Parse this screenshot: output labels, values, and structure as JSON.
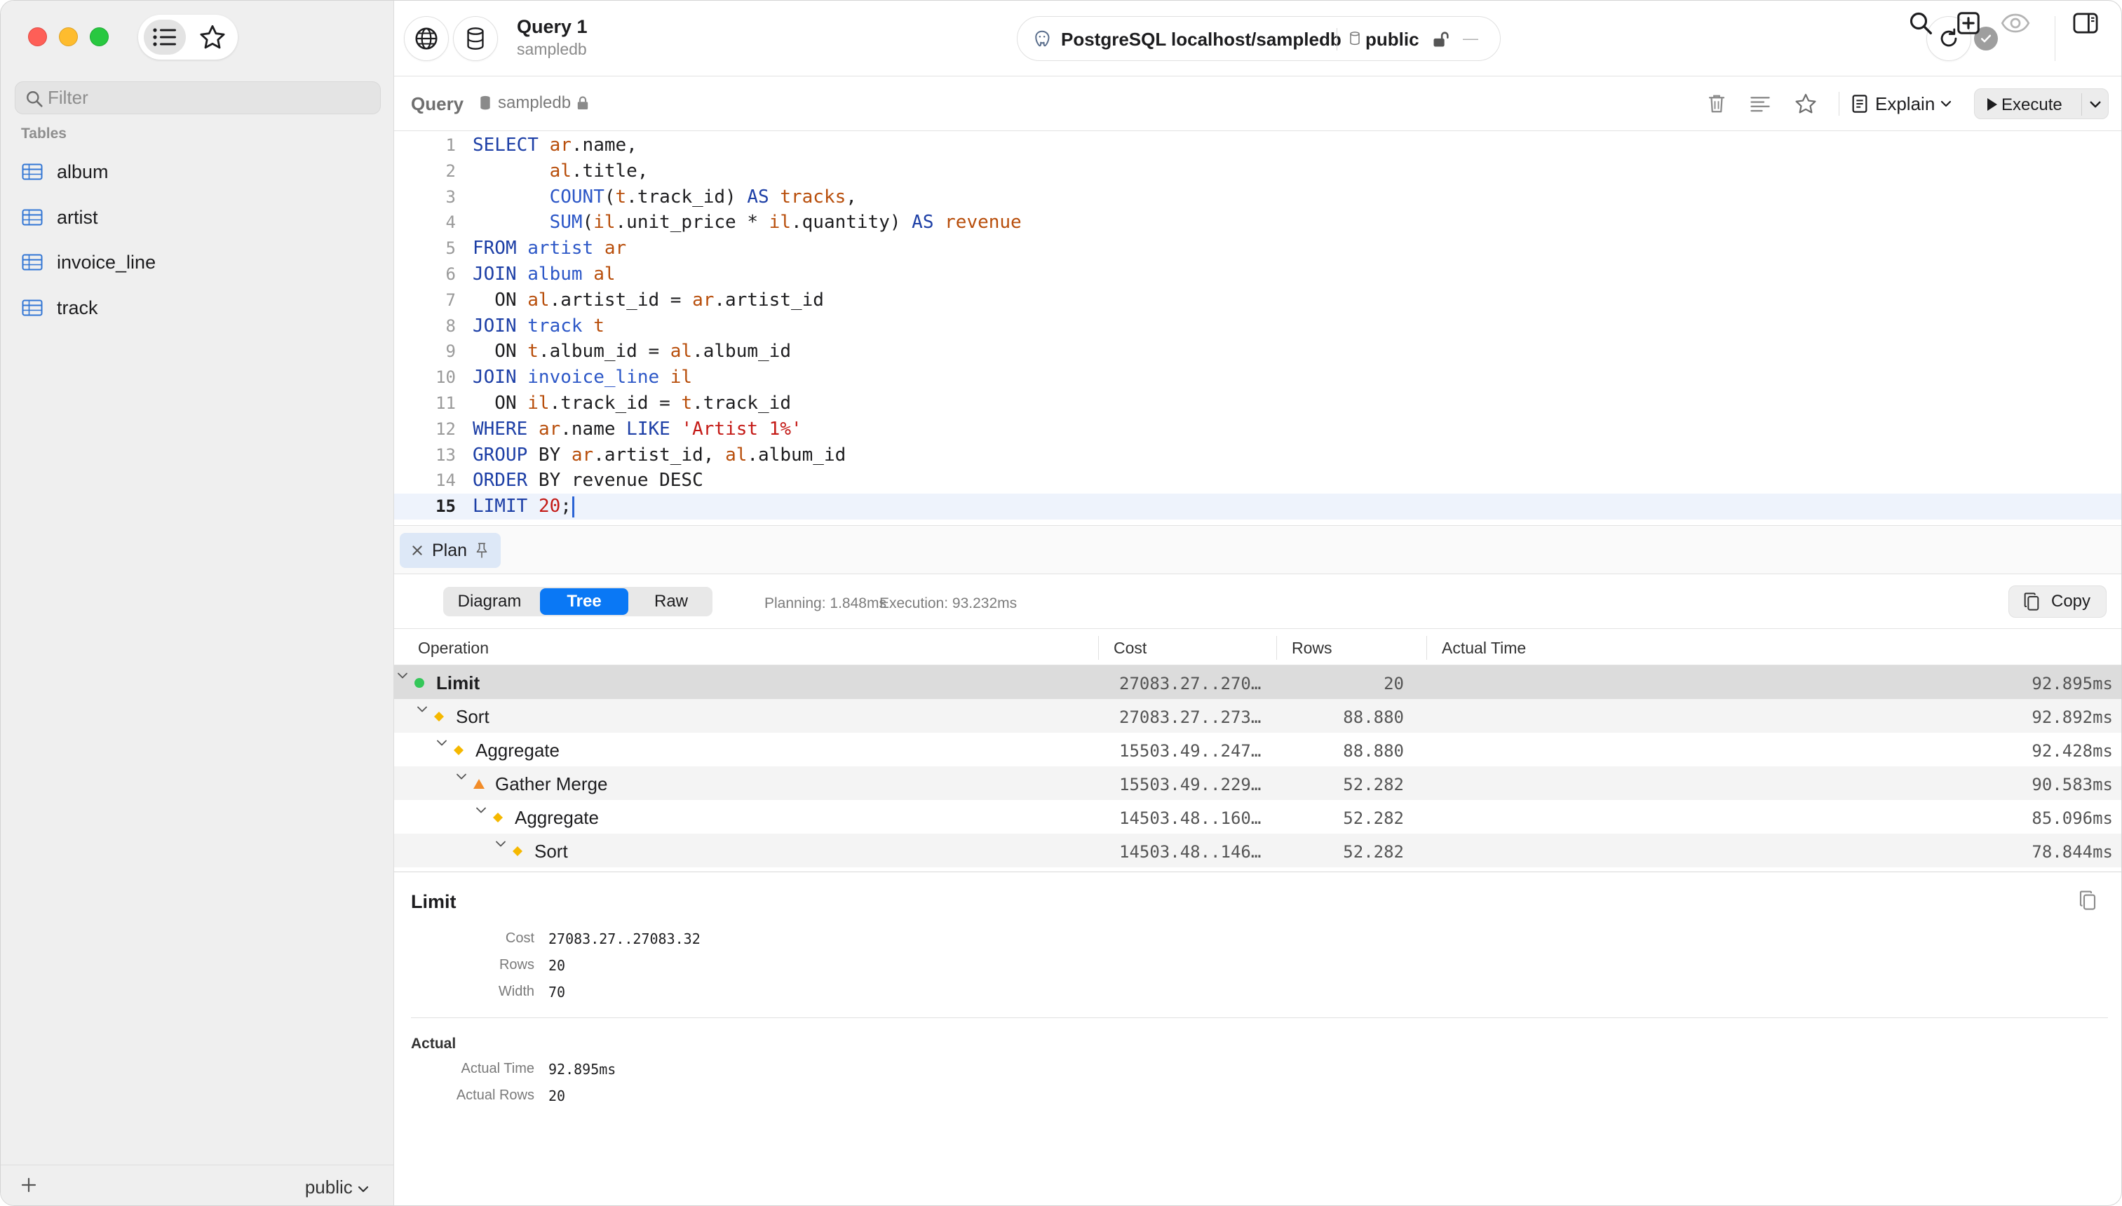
{
  "sidebar": {
    "filter_placeholder": "Filter",
    "tables_heading": "Tables",
    "tables": [
      {
        "label": "album"
      },
      {
        "label": "artist"
      },
      {
        "label": "invoice_line"
      },
      {
        "label": "track"
      }
    ],
    "schema_selector": "public"
  },
  "toolbar": {
    "query_title": "Query 1",
    "query_subtitle": "sampledb",
    "connection_label": "PostgreSQL localhost/sampledb",
    "schema_label": "public",
    "dash": "—"
  },
  "query_header": {
    "label": "Query",
    "database": "sampledb",
    "explain_label": "Explain",
    "execute_label": "Execute"
  },
  "editor": {
    "active_line": 15,
    "lines": [
      {
        "n": "1",
        "tokens": [
          [
            "kw",
            "SELECT"
          ],
          [
            "",
            "&nbsp;"
          ],
          [
            "al",
            "ar"
          ],
          [
            "",
            ".name,"
          ]
        ]
      },
      {
        "n": "2",
        "tokens": [
          [
            "",
            "       "
          ],
          [
            "al",
            "al"
          ],
          [
            "",
            ".title,"
          ]
        ]
      },
      {
        "n": "3",
        "tokens": [
          [
            "",
            "       "
          ],
          [
            "fn",
            "COUNT"
          ],
          [
            "",
            "("
          ],
          [
            "al",
            "t"
          ],
          [
            "",
            ".track_id) "
          ],
          [
            "kw",
            "AS"
          ],
          [
            "",
            " "
          ],
          [
            "al",
            "tracks"
          ],
          [
            "",
            ","
          ]
        ]
      },
      {
        "n": "4",
        "tokens": [
          [
            "",
            "       "
          ],
          [
            "fn",
            "SUM"
          ],
          [
            "",
            "("
          ],
          [
            "al",
            "il"
          ],
          [
            "",
            ".unit_price * "
          ],
          [
            "al",
            "il"
          ],
          [
            "",
            ".quantity) "
          ],
          [
            "kw",
            "AS"
          ],
          [
            "",
            " "
          ],
          [
            "al",
            "revenue"
          ]
        ]
      },
      {
        "n": "5",
        "tokens": [
          [
            "kw",
            "FROM"
          ],
          [
            "",
            " "
          ],
          [
            "tb",
            "artist"
          ],
          [
            "",
            " "
          ],
          [
            "al",
            "ar"
          ]
        ]
      },
      {
        "n": "6",
        "tokens": [
          [
            "kw",
            "JOIN"
          ],
          [
            "",
            " "
          ],
          [
            "tb",
            "album"
          ],
          [
            "",
            " "
          ],
          [
            "al",
            "al"
          ]
        ]
      },
      {
        "n": "7",
        "tokens": [
          [
            "",
            "  ON "
          ],
          [
            "al",
            "al"
          ],
          [
            "",
            ".artist_id = "
          ],
          [
            "al",
            "ar"
          ],
          [
            "",
            ".artist_id"
          ]
        ]
      },
      {
        "n": "8",
        "tokens": [
          [
            "kw",
            "JOIN"
          ],
          [
            "",
            " "
          ],
          [
            "tb",
            "track"
          ],
          [
            "",
            " "
          ],
          [
            "al",
            "t"
          ]
        ]
      },
      {
        "n": "9",
        "tokens": [
          [
            "",
            "  ON "
          ],
          [
            "al",
            "t"
          ],
          [
            "",
            ".album_id = "
          ],
          [
            "al",
            "al"
          ],
          [
            "",
            ".album_id"
          ]
        ]
      },
      {
        "n": "10",
        "tokens": [
          [
            "kw",
            "JOIN"
          ],
          [
            "",
            " "
          ],
          [
            "tb",
            "invoice_line"
          ],
          [
            "",
            " "
          ],
          [
            "al",
            "il"
          ]
        ]
      },
      {
        "n": "11",
        "tokens": [
          [
            "",
            "  ON "
          ],
          [
            "al",
            "il"
          ],
          [
            "",
            ".track_id = "
          ],
          [
            "al",
            "t"
          ],
          [
            "",
            ".track_id"
          ]
        ]
      },
      {
        "n": "12",
        "tokens": [
          [
            "kw",
            "WHERE"
          ],
          [
            "",
            " "
          ],
          [
            "al",
            "ar"
          ],
          [
            "",
            ".name "
          ],
          [
            "kw",
            "LIKE"
          ],
          [
            "",
            " "
          ],
          [
            "str",
            "'Artist 1%'"
          ]
        ]
      },
      {
        "n": "13",
        "tokens": [
          [
            "kw",
            "GROUP"
          ],
          [
            "",
            " BY "
          ],
          [
            "al",
            "ar"
          ],
          [
            "",
            ".artist_id, "
          ],
          [
            "al",
            "al"
          ],
          [
            "",
            ".album_id"
          ]
        ]
      },
      {
        "n": "14",
        "tokens": [
          [
            "kw",
            "ORDER"
          ],
          [
            "",
            " BY revenue DESC"
          ]
        ]
      },
      {
        "n": "15",
        "tokens": [
          [
            "kw",
            "LIMIT"
          ],
          [
            "",
            " "
          ],
          [
            "num",
            "20"
          ],
          [
            "",
            ";"
          ]
        ]
      }
    ]
  },
  "plan": {
    "tab_label": "Plan",
    "views": [
      "Diagram",
      "Tree",
      "Raw"
    ],
    "active_view": "Tree",
    "planning": "Planning: 1.848ms",
    "execution": "Execution: 93.232ms",
    "copy_label": "Copy",
    "columns": [
      "Operation",
      "Cost",
      "Rows",
      "Actual Time"
    ],
    "rows": [
      {
        "op": "Limit",
        "marker": "circle",
        "color": "#34c759",
        "depth": 0,
        "cost": "27083.27..270…",
        "rows": "20",
        "time": "92.895ms",
        "selected": true
      },
      {
        "op": "Sort",
        "marker": "diamond",
        "color": "#f5b800",
        "depth": 1,
        "cost": "27083.27..273…",
        "rows": "88.880",
        "time": "92.892ms"
      },
      {
        "op": "Aggregate",
        "marker": "diamond",
        "color": "#f5b800",
        "depth": 2,
        "cost": "15503.49..247…",
        "rows": "88.880",
        "time": "92.428ms"
      },
      {
        "op": "Gather Merge",
        "marker": "triangle",
        "color": "#f28c28",
        "depth": 3,
        "cost": "15503.49..229…",
        "rows": "52.282",
        "time": "90.583ms"
      },
      {
        "op": "Aggregate",
        "marker": "diamond",
        "color": "#f5b800",
        "depth": 4,
        "cost": "14503.48..160…",
        "rows": "52.282",
        "time": "85.096ms"
      },
      {
        "op": "Sort",
        "marker": "diamond",
        "color": "#f5b800",
        "depth": 5,
        "cost": "14503.48..146…",
        "rows": "52.282",
        "time": "78.844ms"
      }
    ]
  },
  "detail": {
    "title": "Limit",
    "props": [
      {
        "k": "Cost",
        "v": "27083.27..27083.32"
      },
      {
        "k": "Rows",
        "v": "20"
      },
      {
        "k": "Width",
        "v": "70"
      }
    ],
    "actual_heading": "Actual",
    "actual": [
      {
        "k": "Actual Time",
        "v": "92.895ms"
      },
      {
        "k": "Actual Rows",
        "v": "20"
      }
    ]
  }
}
